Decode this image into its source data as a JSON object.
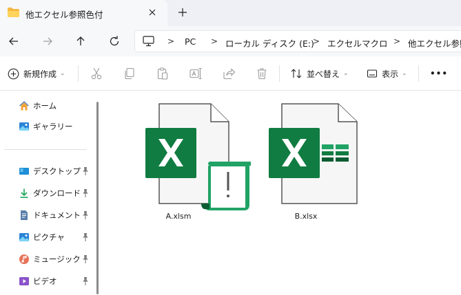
{
  "tab": {
    "title": "他エクセル参照色付",
    "close_icon": "close-icon",
    "new_tab_icon": "plus-icon"
  },
  "nav": {
    "back_icon": "arrow-left-icon",
    "forward_icon": "arrow-right-icon",
    "up_icon": "arrow-up-icon",
    "refresh_icon": "refresh-icon"
  },
  "breadcrumb": {
    "pc_icon": "monitor-icon",
    "items": [
      "PC",
      "ローカル ディスク (E:)",
      "エクセルマクロ",
      "他エクセル参照"
    ]
  },
  "commands": {
    "new_label": "新規作成",
    "sort_label": "並べ替え",
    "view_label": "表示",
    "more_label": "•••"
  },
  "sidebar": {
    "quick": [
      {
        "label": "ホーム",
        "icon": "home-icon"
      },
      {
        "label": "ギャラリー",
        "icon": "gallery-icon"
      }
    ],
    "pinned": [
      {
        "label": "デスクトップ",
        "icon": "desktop-icon"
      },
      {
        "label": "ダウンロード",
        "icon": "download-icon"
      },
      {
        "label": "ドキュメント",
        "icon": "document-icon"
      },
      {
        "label": "ピクチャ",
        "icon": "pictures-icon"
      },
      {
        "label": "ミュージック",
        "icon": "music-icon"
      },
      {
        "label": "ビデオ",
        "icon": "video-icon"
      }
    ]
  },
  "files": [
    {
      "name": "A.xlsm",
      "icon": "excel-macro-file-icon"
    },
    {
      "name": "B.xlsx",
      "icon": "excel-file-icon"
    }
  ],
  "colors": {
    "excel_green": "#107c41",
    "excel_light_green": "#21a366",
    "page_gray": "#f7f8fa"
  }
}
